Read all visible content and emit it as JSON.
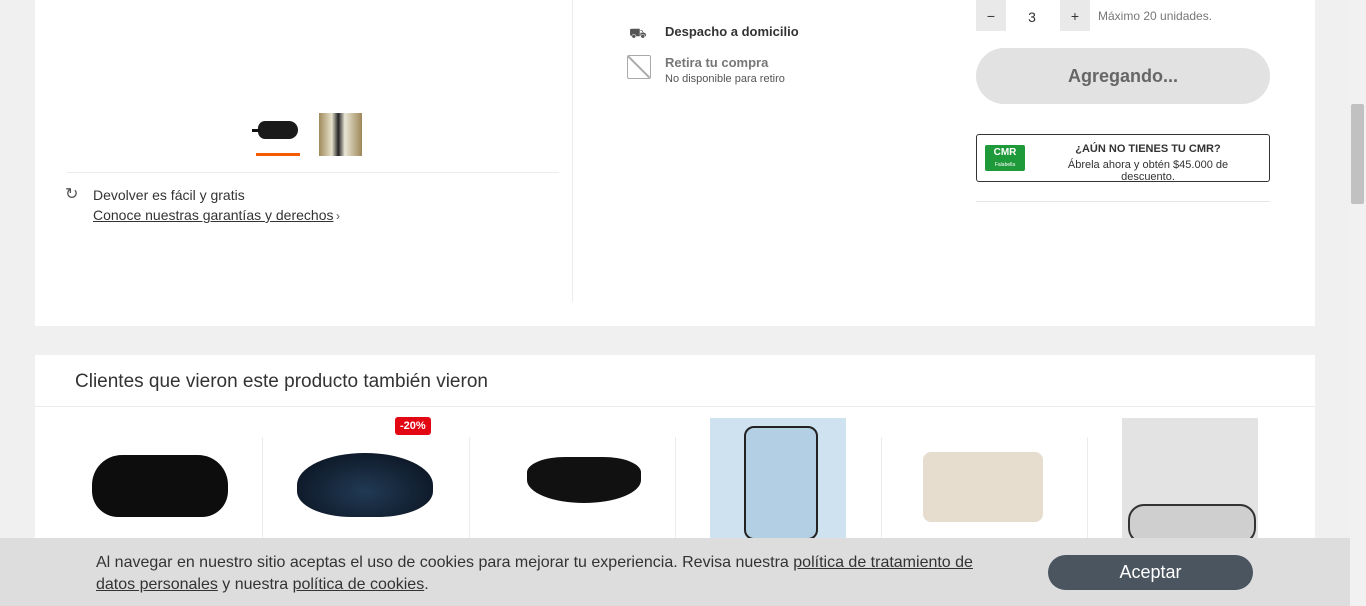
{
  "product": {
    "return_title": "Devolver es fácil y gratis",
    "return_link": "Conoce nuestras garantías y derechos",
    "delivery_label": "Despacho a domicilio",
    "pickup_label": "Retira tu compra",
    "pickup_sub": "No disponible para retiro",
    "qty_minus": "−",
    "qty_plus": "+",
    "qty_value": "3",
    "qty_max": "Máximo 20 unidades.",
    "add_button": "Agregando...",
    "cmr_logo": "CMR",
    "cmr_logo_sub": "Falabella",
    "cmr_title": "¿AÚN NO TIENES TU CMR?",
    "cmr_sub": "Ábrela ahora y obtén $45.000 de descuento."
  },
  "recommendations": {
    "title": "Clientes que vieron este producto también vieron",
    "discount_badge": "-20%"
  },
  "cookie": {
    "text_1": "Al navegar en nuestro sitio aceptas el uso de cookies para mejorar tu experiencia. Revisa nuestra ",
    "link_1": "política de tratamiento de datos personales",
    "text_2": " y nuestra ",
    "link_2": "política de cookies",
    "text_3": ".",
    "accept": "Aceptar"
  },
  "colors": {
    "accent_orange": "#f35b04",
    "discount_red": "#e30613",
    "cmr_green": "#1f9a3b",
    "accept_button": "#4a5560"
  }
}
